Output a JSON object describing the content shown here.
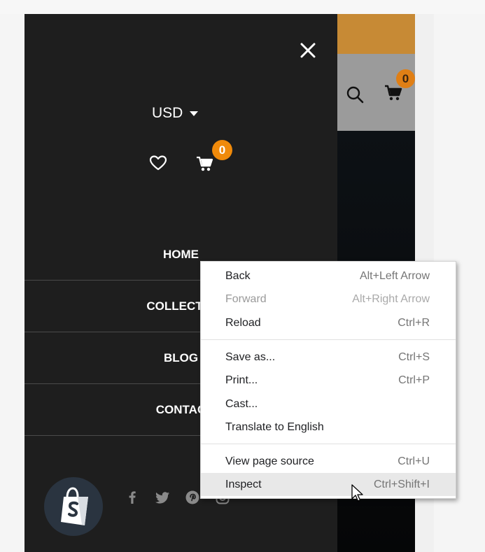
{
  "site": {
    "cart_count": "0"
  },
  "drawer": {
    "currency": "USD",
    "cart_count": "0",
    "nav": [
      "HOME",
      "COLLECTIO",
      "BLOG",
      "CONTAC"
    ],
    "social_icons": [
      "facebook-icon",
      "twitter-icon",
      "pinterest-icon",
      "instagram-icon"
    ]
  },
  "context_menu": {
    "groups": [
      [
        {
          "label": "Back",
          "shortcut": "Alt+Left Arrow",
          "enabled": true
        },
        {
          "label": "Forward",
          "shortcut": "Alt+Right Arrow",
          "enabled": false
        },
        {
          "label": "Reload",
          "shortcut": "Ctrl+R",
          "enabled": true
        }
      ],
      [
        {
          "label": "Save as...",
          "shortcut": "Ctrl+S",
          "enabled": true
        },
        {
          "label": "Print...",
          "shortcut": "Ctrl+P",
          "enabled": true
        },
        {
          "label": "Cast...",
          "shortcut": "",
          "enabled": true
        },
        {
          "label": "Translate to English",
          "shortcut": "",
          "enabled": true
        }
      ],
      [
        {
          "label": "View page source",
          "shortcut": "Ctrl+U",
          "enabled": true
        },
        {
          "label": "Inspect",
          "shortcut": "Ctrl+Shift+I",
          "enabled": true,
          "hovered": true
        }
      ]
    ]
  },
  "colors": {
    "drawer_bg": "#1e1e1e",
    "badge_orange": "#f08a0a",
    "announce_bar": "#c78a35",
    "menu_hover": "#e8e8e8"
  }
}
